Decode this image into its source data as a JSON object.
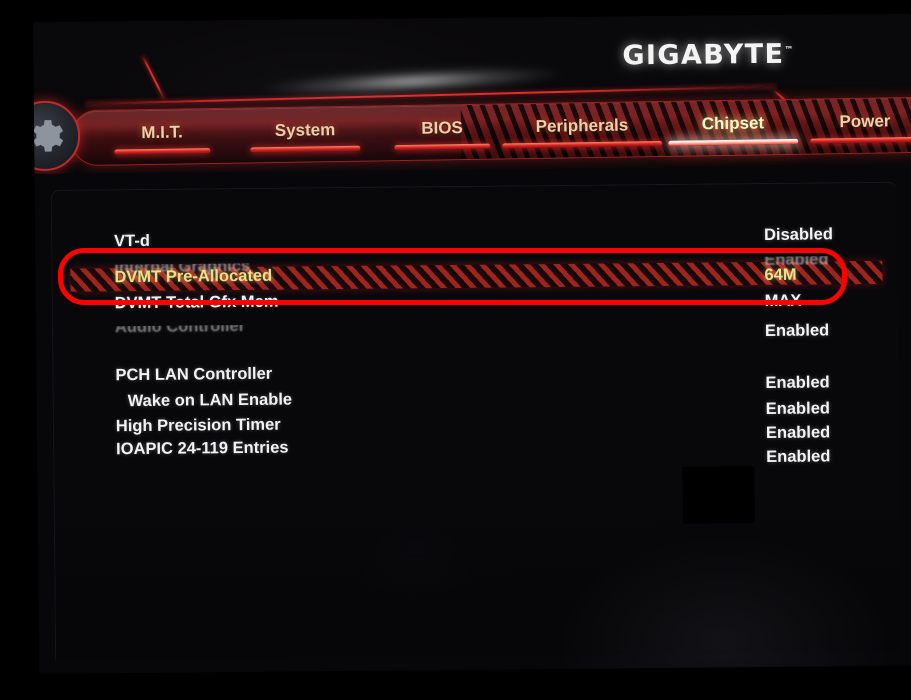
{
  "brand": {
    "logo_text": "GIGABYTE",
    "logo_tm": "™"
  },
  "nav": {
    "gear_icon": "gear-icon",
    "tabs": [
      {
        "label": "M.I.T.",
        "active": false
      },
      {
        "label": "System",
        "active": false
      },
      {
        "label": "BIOS",
        "active": false
      },
      {
        "label": "Peripherals",
        "active": false
      },
      {
        "label": "Chipset",
        "active": true
      },
      {
        "label": "Power",
        "active": false
      }
    ]
  },
  "settings": {
    "rows": [
      {
        "label": "VT-d",
        "value": "Disabled",
        "state": "normal",
        "indent": false
      },
      {
        "label": "Internal Graphics",
        "value": "Enabled",
        "state": "ghost",
        "indent": false
      },
      {
        "label": "DVMT Pre-Allocated",
        "value": "64M",
        "state": "selected",
        "indent": false
      },
      {
        "label": "DVMT Total Gfx Mem",
        "value": "MAX",
        "state": "normal",
        "indent": false
      },
      {
        "label": "Audio Controller",
        "value": "Enabled",
        "state": "ghost-b",
        "indent": false
      },
      {
        "label": "PCH LAN Controller",
        "value": "Enabled",
        "state": "normal",
        "indent": false
      },
      {
        "label": "Wake on LAN Enable",
        "value": "Enabled",
        "state": "normal",
        "indent": true
      },
      {
        "label": "High Precision Timer",
        "value": "Enabled",
        "state": "normal",
        "indent": false
      },
      {
        "label": "IOAPIC 24-119 Entries",
        "value": "Enabled",
        "state": "normal",
        "indent": false
      }
    ]
  },
  "annotation": {
    "shape": "rounded-rectangle-outline",
    "color": "#fe0000",
    "targets": [
      "DVMT Pre-Allocated",
      "DVMT Total Gfx Mem"
    ]
  },
  "colors": {
    "accent_red": "#d42626",
    "selected_yellow": "#ece08a",
    "tab_label": "#f0cfae",
    "active_tab_label": "#fbf6c8",
    "value_text": "#f4f4f4",
    "screen_bg": "#08080b",
    "annotation_red": "#fe0000"
  }
}
